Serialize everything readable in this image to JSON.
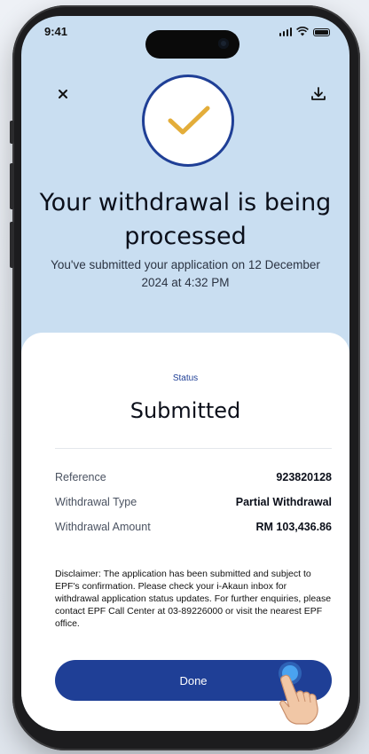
{
  "statusbar": {
    "time": "9:41"
  },
  "header": {
    "close_icon": "close-icon",
    "download_icon": "download-icon"
  },
  "hero": {
    "check_icon": "checkmark-icon",
    "title": "Your withdrawal is being processed",
    "subtitle": "You've submitted your application on 12 December 2024 at 4:32 PM"
  },
  "status": {
    "label": "Status",
    "value": "Submitted"
  },
  "details": [
    {
      "key": "Reference",
      "value": "923820128"
    },
    {
      "key": "Withdrawal Type",
      "value": "Partial Withdrawal"
    },
    {
      "key": "Withdrawal Amount",
      "value": "RM 103,436.86"
    }
  ],
  "disclaimer": "Disclaimer: The application has been submitted and subject to EPF's confirmation. Please check your i-Akaun inbox for withdrawal application status updates. For further enquiries, please contact EPF Call Center at 03-89226000 or visit the nearest EPF office.",
  "actions": {
    "done_label": "Done"
  },
  "colors": {
    "primary": "#1f3f96",
    "hero_background": "#c9def1",
    "check_color": "#e3ad3a"
  }
}
